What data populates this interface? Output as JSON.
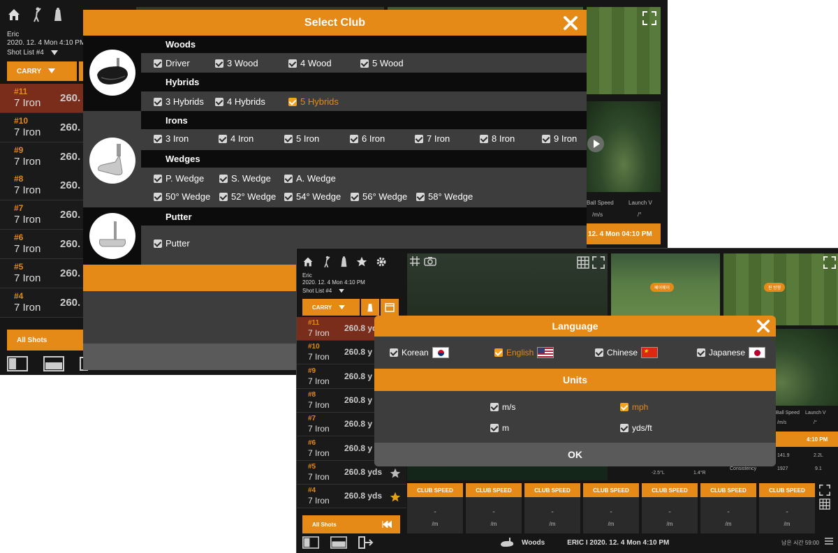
{
  "window1": {
    "user": "Eric",
    "date": "2020. 12. 4 Mon 4:10 PM",
    "shot_list": "Shot List #4",
    "carry_label": "CARRY",
    "shots": [
      {
        "num": "#11",
        "club": "7 Iron",
        "dist": "260."
      },
      {
        "num": "#10",
        "club": "7 Iron",
        "dist": "260."
      },
      {
        "num": "#9",
        "club": "7 Iron",
        "dist": "260."
      },
      {
        "num": "#8",
        "club": "7 Iron",
        "dist": "260."
      },
      {
        "num": "#7",
        "club": "7 Iron",
        "dist": "260."
      },
      {
        "num": "#6",
        "club": "7 Iron",
        "dist": "260."
      },
      {
        "num": "#5",
        "club": "7 Iron",
        "dist": "260."
      },
      {
        "num": "#4",
        "club": "7 Iron",
        "dist": "260."
      }
    ],
    "all_shots": "All Shots",
    "right_panel": {
      "ball_speed": "Ball Speed",
      "launch_v": "Launch V",
      "unit1": "/m/s",
      "unit2": "/°",
      "date_banner": "12. 4 Mon 04:10 PM"
    }
  },
  "select_club": {
    "title": "Select Club",
    "woods": {
      "label": "Woods",
      "items": [
        "Driver",
        "3 Wood",
        "4 Wood",
        "5 Wood"
      ]
    },
    "hybrids": {
      "label": "Hybrids",
      "items": [
        "3 Hybrids",
        "4 Hybrids",
        "5 Hybrids"
      ]
    },
    "irons": {
      "label": "Irons",
      "items": [
        "3 Iron",
        "4 Iron",
        "5 Iron",
        "6 Iron",
        "7 Iron",
        "8 Iron",
        "9 Iron"
      ]
    },
    "wedges": {
      "label": "Wedges",
      "items": [
        "P. Wedge",
        "S. Wedge",
        "A. Wedge",
        "50° Wedge",
        "52° Wedge",
        "54° Wedge",
        "56° Wedge",
        "58° Wedge"
      ]
    },
    "putter": {
      "label": "Putter",
      "items": [
        "Putter"
      ]
    }
  },
  "window2": {
    "user": "Eric",
    "date": "2020. 12. 4 Mon 4:10 PM",
    "shot_list": "Shot List #4",
    "carry_label": "CARRY",
    "shots": [
      {
        "num": "#11",
        "club": "7 Iron",
        "dist": "260.8 yds"
      },
      {
        "num": "#10",
        "club": "7 Iron",
        "dist": "260.8 y"
      },
      {
        "num": "#9",
        "club": "7 Iron",
        "dist": "260.8 y"
      },
      {
        "num": "#8",
        "club": "7 Iron",
        "dist": "260.8 y"
      },
      {
        "num": "#7",
        "club": "7 Iron",
        "dist": "260.8 y"
      },
      {
        "num": "#6",
        "club": "7 Iron",
        "dist": "260.8 y"
      },
      {
        "num": "#5",
        "club": "7 Iron",
        "dist": "260.8 yds"
      },
      {
        "num": "#4",
        "club": "7 Iron",
        "dist": "260.8 yds"
      }
    ],
    "all_shots": "All Shots",
    "club_speed_label": "CLUB SPEED",
    "dash": "-",
    "unit": "/m",
    "bottom_club": "Woods",
    "bottom_info": "ERIC I 2020. 12. 4 Mon 4:10 PM",
    "time_left": "남은 시간 59:00",
    "map_tag1": "페어웨이",
    "map_tag2": "핀 방향",
    "right_panel": {
      "ball_speed": "Ball Speed",
      "launch_v": "Launch V",
      "unit1": "/m/s",
      "unit2": "/°",
      "date_banner": "4:10 PM",
      "row1_val1": "141.9",
      "row1_val2": "2.2L",
      "consistency": "Consistency",
      "row2_val1": "1927",
      "row2_val2": "9.1",
      "small1": "-2.5°L",
      "small2": "1.4°R"
    }
  },
  "language": {
    "title": "Language",
    "options": [
      {
        "label": "Korean",
        "checked": false
      },
      {
        "label": "English",
        "checked": true
      },
      {
        "label": "Chinese",
        "checked": false
      },
      {
        "label": "Japanese",
        "checked": false
      }
    ],
    "units_title": "Units",
    "unit_options": [
      {
        "label": "m/s",
        "checked": false
      },
      {
        "label": "mph",
        "checked": true
      },
      {
        "label": "m",
        "checked": false
      },
      {
        "label": "yds/ft",
        "checked": false
      }
    ],
    "ok": "OK"
  },
  "colors": {
    "accent": "#e58a17",
    "dialog": "#3d3d3d",
    "selected_row": "#7a2d1a"
  }
}
